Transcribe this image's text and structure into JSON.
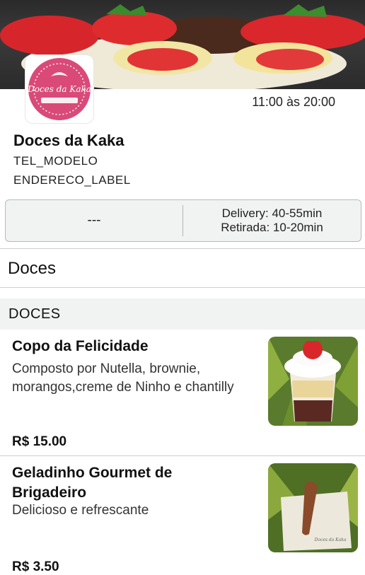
{
  "store": {
    "logo_text": "Doces da Kaka",
    "hours": "11:00 às 20:00",
    "name": "Doces da Kaka",
    "phone": "TEL_MODELO",
    "address": "ENDERECO_LABEL"
  },
  "info": {
    "left": "---",
    "delivery": "Delivery: 40-55min",
    "pickup": "Retirada: 10-20min"
  },
  "menu": {
    "title": "Doces",
    "categories": [
      {
        "label": "DOCES",
        "products": [
          {
            "name": "Copo da Felicidade",
            "description": "Composto por Nutella, brownie, morangos,creme de Ninho e chantilly",
            "price": "R$ 15.00"
          },
          {
            "name": "Geladinho Gourmet de Brigadeiro",
            "description": "Delicioso e refrescante",
            "price": "R$ 3.50"
          }
        ]
      }
    ]
  },
  "colors": {
    "brand_pink": "#d94a78",
    "panel_bg": "#f1f2f2",
    "strawberry": "#e0262b"
  }
}
